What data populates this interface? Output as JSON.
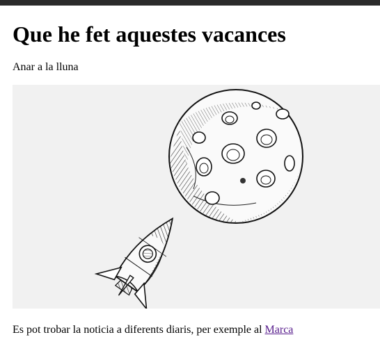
{
  "page": {
    "heading": "Que he fet aquestes vacances",
    "subtitle": "Anar a la lluna",
    "footer_prefix": "Es pot trobar la noticia a diferents diaris, per exemple al ",
    "footer_link": "Marca"
  },
  "image": {
    "subject": "moon-and-rocket-illustration"
  },
  "colors": {
    "page_bg": "#ffffff",
    "image_bg": "#f1f1f1",
    "visited_link": "#551a8b",
    "chrome": "#2b2b2b"
  }
}
